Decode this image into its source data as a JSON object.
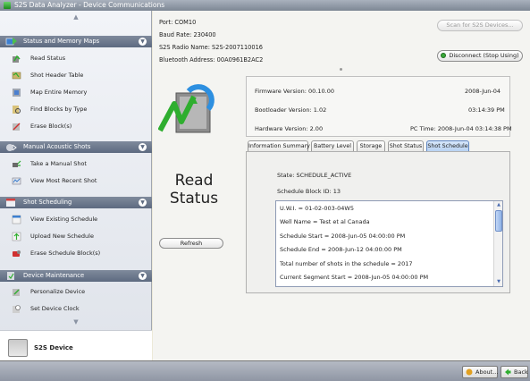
{
  "window": {
    "title": "S2S Data Analyzer - Device Communications"
  },
  "sidebar": {
    "sections": [
      {
        "label": "Status and Memory Maps",
        "items": [
          "Read Status",
          "Shot Header Table",
          "Map Entire Memory",
          "Find Blocks by Type",
          "Erase Block(s)"
        ]
      },
      {
        "label": "Manual Acoustic Shots",
        "items": [
          "Take a Manual Shot",
          "View Most Recent Shot"
        ]
      },
      {
        "label": "Shot Scheduling",
        "items": [
          "View Existing Schedule",
          "Upload New Schedule",
          "Erase Schedule Block(s)"
        ]
      },
      {
        "label": "Device Maintenance",
        "items": [
          "Personalize Device",
          "Set Device Clock"
        ]
      }
    ],
    "device_label": "S2S Device"
  },
  "connection": {
    "port": "Port: COM10",
    "baud": "Baud Rate: 230400",
    "radio": "S2S Radio Name: S2S-2007110016",
    "bluetooth": "Bluetooth Address: 00A0961B2AC2",
    "scan_label": "Scan for S2S Devices...",
    "disconnect_label": "Disconnect (Stop Using)"
  },
  "page": {
    "title_line1": "Read",
    "title_line2": "Status",
    "refresh_label": "Refresh"
  },
  "versions": {
    "firmware": "Firmware Version: 00.10.00",
    "firmware_date": "2008-Jun-04",
    "bootloader": "Bootloader Version: 1.02",
    "bootloader_time": "03:14:39 PM",
    "hardware": "Hardware Version: 2.00",
    "pc_time": "PC Time: 2008-Jun-04 03:14:38 PM"
  },
  "tabs": [
    "Information Summary",
    "Battery Level",
    "Storage",
    "Shot Status",
    "Shot Schedule"
  ],
  "active_tab": "Shot Schedule",
  "schedule": {
    "state": "State: SCHEDULE_ACTIVE",
    "block_id": "Schedule Block ID: 13",
    "lines": [
      "U.W.I. = 01-02-003-04W5",
      "Well Name  = Test et al Canada",
      "Schedule Start = 2008-Jun-05  04:00:00 PM",
      "Schedule End = 2008-Jun-12  04:00:00 PM",
      "Total number of shots in the schedule = 2017",
      "Current Segment Start = 2008-Jun-05  04:00:00 PM"
    ]
  },
  "bottom": {
    "about_label": "About...",
    "back_label": "Back"
  },
  "colors": {
    "section_header": "#5d6a80",
    "active_tab": "#b8d2f2",
    "title_bar": "#7d8794"
  }
}
